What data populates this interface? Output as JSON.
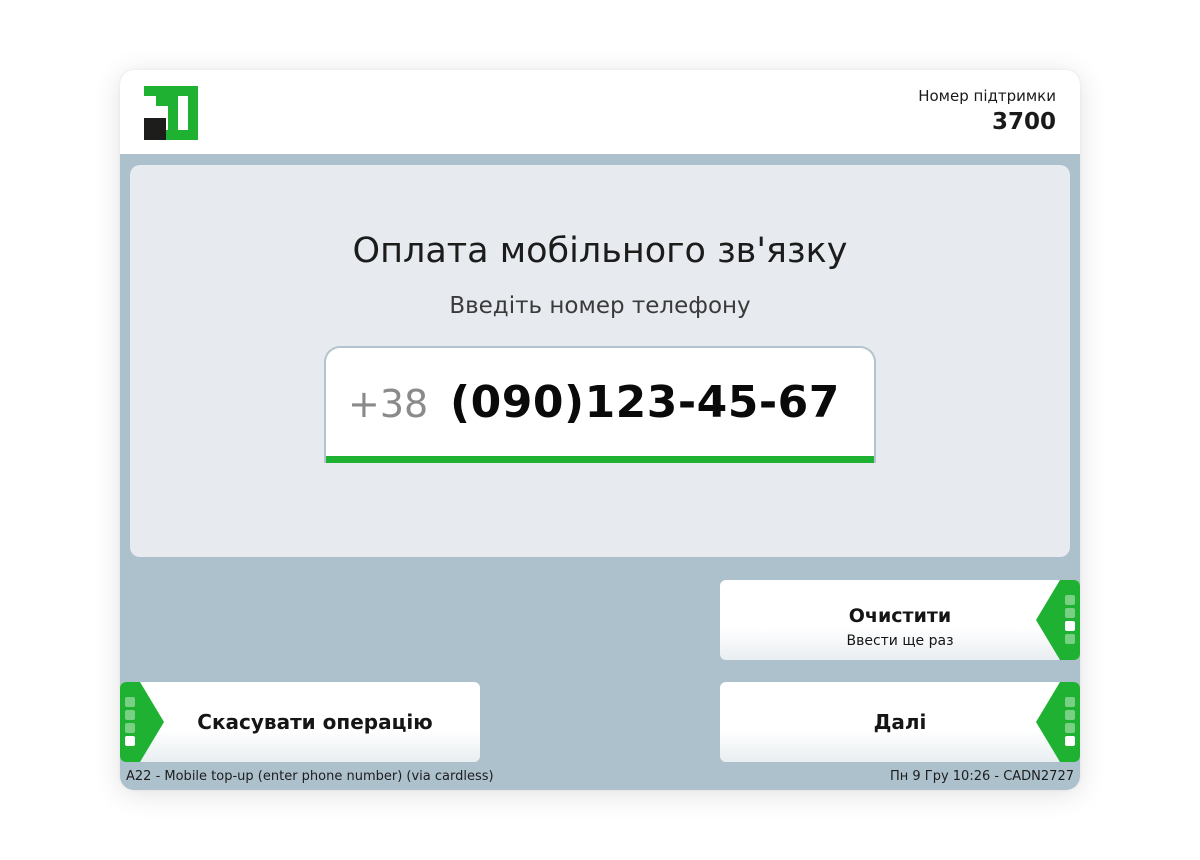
{
  "header": {
    "support_label": "Номер підтримки",
    "support_number": "3700"
  },
  "main": {
    "title": "Оплата мобільного зв'язку",
    "subtitle": "Введіть номер телефону",
    "phone_prefix": "+38",
    "phone_value": "(090)123-45-67"
  },
  "buttons": {
    "clear_label": "Очистити",
    "clear_sublabel": "Ввести ще раз",
    "next_label": "Далі",
    "cancel_label": "Скасувати операцію"
  },
  "footer": {
    "screen_info": "A22 - Mobile top-up (enter phone number) (via cardless)",
    "status_info": "Пн 9 Гру 10:26 - CADN2727"
  },
  "colors": {
    "brand_green": "#1fb132",
    "frame_bg": "#adc1cd",
    "panel_bg": "#e7ebef"
  },
  "icons": {
    "logo": "privatbank-logo",
    "button_tab": "green-arrow-tab-icon"
  }
}
